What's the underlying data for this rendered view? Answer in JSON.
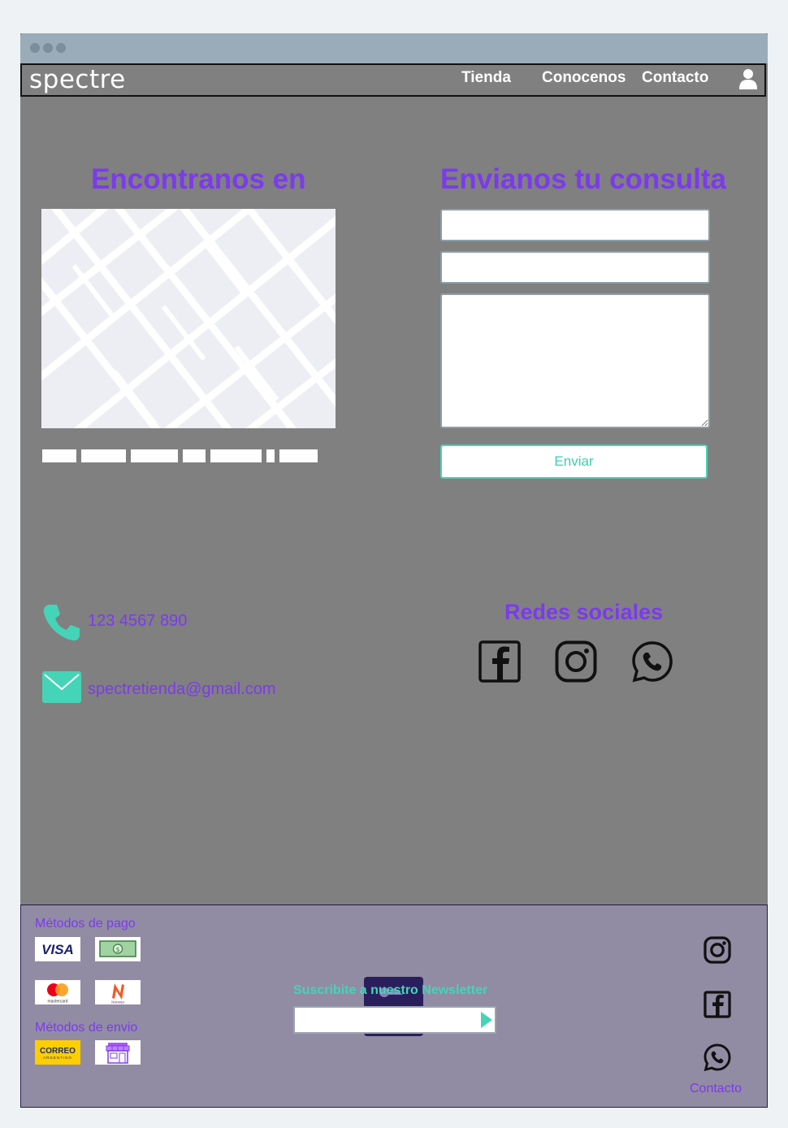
{
  "nav": {
    "logo": "spectre",
    "links": [
      "Tienda",
      "Conocenos",
      "Contacto"
    ]
  },
  "location": {
    "heading": "Encontranos en"
  },
  "contact_form": {
    "heading": "Envianos tu consulta",
    "submit_label": "Enviar"
  },
  "contact_info": {
    "phone": "123 4567 890",
    "email": "spectretienda@gmail.com"
  },
  "social": {
    "heading": "Redes sociales",
    "icons": [
      "facebook-icon",
      "instagram-icon",
      "whatsapp-icon"
    ]
  },
  "footer": {
    "payment_heading": "Métodos de pago",
    "payment_methods": [
      "VISA",
      "cash",
      "mastercard",
      "Naranja"
    ],
    "shipping_heading": "Métodos de envio",
    "shipping_methods": [
      "CORREO ARGENTINO",
      "store-pickup"
    ],
    "newsletter_prefix": "Suscribite a nuestro",
    "newsletter_strong": "Newsletter",
    "contact_label": "Contacto"
  },
  "colors": {
    "accent_purple": "#7c3aed",
    "accent_teal": "#45d4b8",
    "page_bg": "#808080",
    "footer_bg": "#918ca3"
  }
}
